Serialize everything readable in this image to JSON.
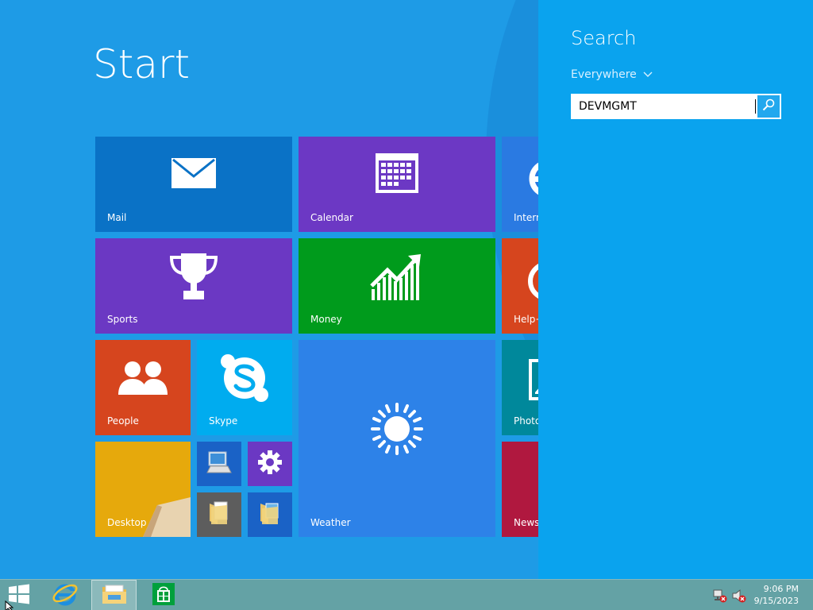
{
  "start": {
    "title": "Start"
  },
  "tiles": [
    {
      "label": "Mail",
      "color": "#0a72c6",
      "icon": "mail-icon"
    },
    {
      "label": "Calendar",
      "color": "#6c38c4",
      "icon": "calendar-icon"
    },
    {
      "label": "Intern",
      "color": "#2a7ae2",
      "icon": "internet-explorer-icon"
    },
    {
      "label": "Sports",
      "color": "#6b38c3",
      "icon": "trophy-icon"
    },
    {
      "label": "Money",
      "color": "#009b1c",
      "icon": "chart-up-icon"
    },
    {
      "label": "Help+",
      "color": "#d6451e",
      "icon": "help-icon"
    },
    {
      "label": "People",
      "color": "#d6451e",
      "icon": "people-icon"
    },
    {
      "label": "Skype",
      "color": "#00acef",
      "icon": "skype-icon"
    },
    {
      "label": "Weather",
      "color": "#2d82e8",
      "icon": "sun-icon"
    },
    {
      "label": "Photo",
      "color": "#00889b",
      "icon": "photo-icon"
    },
    {
      "label": "Desktop",
      "color": "#e6a90c",
      "icon": "desktop-wallpaper-icon"
    },
    {
      "label": "",
      "color": "#1a62c6",
      "icon": "computer-icon"
    },
    {
      "label": "",
      "color": "#6b38c3",
      "icon": "settings-gear-icon"
    },
    {
      "label": "",
      "color": "#5d5d5d",
      "icon": "documents-folder-icon"
    },
    {
      "label": "",
      "color": "#1a62c6",
      "icon": "pictures-folder-icon"
    },
    {
      "label": "News",
      "color": "#b0183f",
      "icon": "news-icon"
    }
  ],
  "search": {
    "heading": "Search",
    "scope": "Everywhere",
    "query": "DEVMGMT"
  },
  "taskbar": {
    "time": "9:06 PM",
    "date": "9/15/2023"
  },
  "colors": {
    "background": "#1e9be6",
    "search_pane": "#0aa3ee",
    "taskbar": "#64a2a5"
  }
}
